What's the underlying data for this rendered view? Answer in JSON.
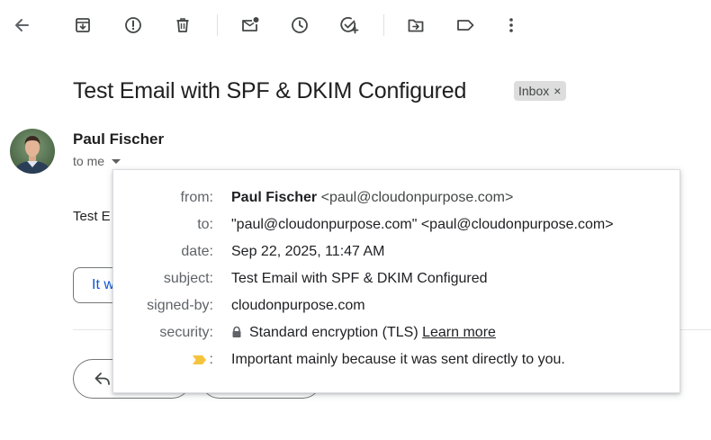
{
  "toolbar": {
    "icons": [
      "back-arrow-icon",
      "archive-icon",
      "report-spam-icon",
      "delete-icon",
      "mark-unread-icon",
      "snooze-icon",
      "add-to-tasks-icon",
      "move-to-icon",
      "label-icon",
      "more-options-icon"
    ]
  },
  "email": {
    "subject": "Test Email with SPF & DKIM Configured",
    "label_chip": "Inbox",
    "label_chip_close": "×",
    "sender_name": "Paul Fischer",
    "to_line": "to me",
    "body_snippet": "Test E",
    "smart_reply": "It w"
  },
  "details": {
    "from_key": "from:",
    "from_name": "Paul Fischer",
    "from_email": "<paul@cloudonpurpose.com>",
    "to_key": "to:",
    "to_value": "\"paul@cloudonpurpose.com\" <paul@cloudonpurpose.com>",
    "date_key": "date:",
    "date_value": "Sep 22, 2025, 11:47 AM",
    "subject_key": "subject:",
    "subject_value": "Test Email with SPF & DKIM Configured",
    "signed_by_key": "signed-by:",
    "signed_by_value": "cloudonpurpose.com",
    "security_key": "security:",
    "security_value": "Standard encryption (TLS)",
    "security_link": "Learn more",
    "importance_colon": ":",
    "importance_value": "Important mainly because it was sent directly to you.",
    "importance_color": "#f4c43d"
  }
}
